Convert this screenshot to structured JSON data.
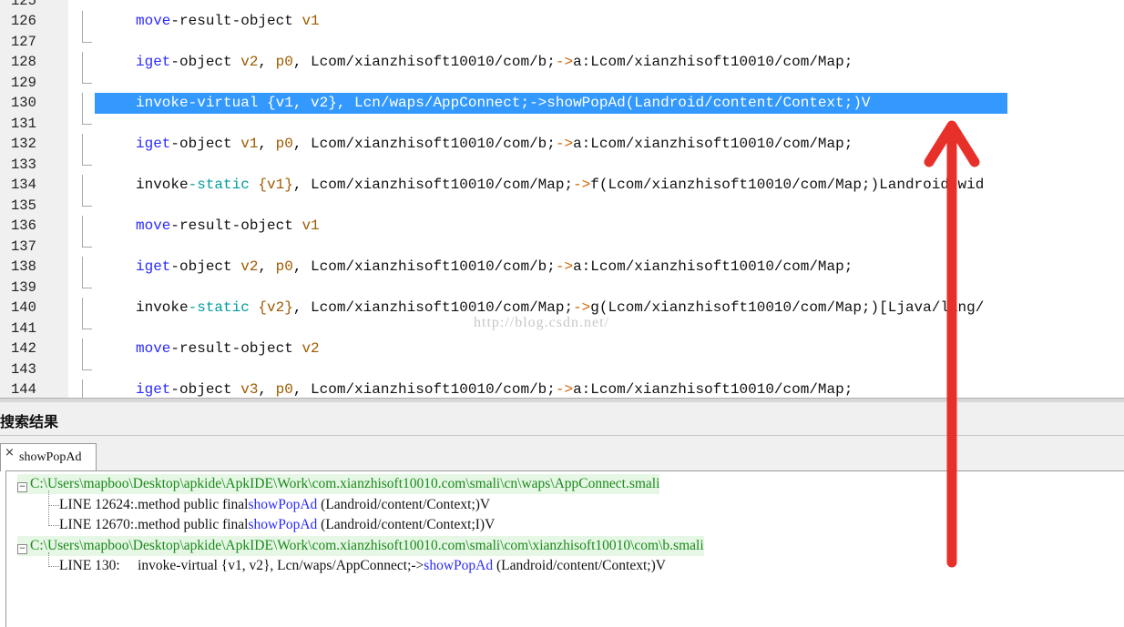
{
  "editor": {
    "partial_top_line_number": "125",
    "lines": [
      {
        "num": "126",
        "parts": [
          {
            "t": "move",
            "c": "kw"
          },
          {
            "t": "-result-object ",
            "c": ""
          },
          {
            "t": "v1",
            "c": "reg"
          }
        ]
      },
      {
        "num": "127",
        "parts": []
      },
      {
        "num": "128",
        "parts": [
          {
            "t": "iget",
            "c": "kw"
          },
          {
            "t": "-object ",
            "c": ""
          },
          {
            "t": "v2",
            "c": "reg"
          },
          {
            "t": ", ",
            "c": ""
          },
          {
            "t": "p0",
            "c": "reg"
          },
          {
            "t": ", Lcom/xianzhisoft10010/com/b;",
            "c": ""
          },
          {
            "t": "->",
            "c": "op"
          },
          {
            "t": "a:Lcom/xianzhisoft10010/com/Map;",
            "c": ""
          }
        ]
      },
      {
        "num": "129",
        "parts": []
      },
      {
        "num": "130",
        "selected": true,
        "parts": [
          {
            "t": "invoke-virtual {v1, v2}, Lcn/waps/AppConnect;->showPopAd(Landroid/content/Context;)V",
            "c": ""
          }
        ]
      },
      {
        "num": "131",
        "parts": []
      },
      {
        "num": "132",
        "parts": [
          {
            "t": "iget",
            "c": "kw"
          },
          {
            "t": "-object ",
            "c": ""
          },
          {
            "t": "v1",
            "c": "reg"
          },
          {
            "t": ", ",
            "c": ""
          },
          {
            "t": "p0",
            "c": "reg"
          },
          {
            "t": ", Lcom/xianzhisoft10010/com/b;",
            "c": ""
          },
          {
            "t": "->",
            "c": "op"
          },
          {
            "t": "a:Lcom/xianzhisoft10010/com/Map;",
            "c": ""
          }
        ]
      },
      {
        "num": "133",
        "parts": []
      },
      {
        "num": "134",
        "parts": [
          {
            "t": "invoke",
            "c": ""
          },
          {
            "t": "-static ",
            "c": "st"
          },
          {
            "t": "{v1}",
            "c": "reg"
          },
          {
            "t": ", Lcom/xianzhisoft10010/com/Map;",
            "c": ""
          },
          {
            "t": "->",
            "c": "op"
          },
          {
            "t": "f(Lcom/xianzhisoft10010/com/Map;)Landroid/wid",
            "c": ""
          }
        ]
      },
      {
        "num": "135",
        "parts": []
      },
      {
        "num": "136",
        "parts": [
          {
            "t": "move",
            "c": "kw"
          },
          {
            "t": "-result-object ",
            "c": ""
          },
          {
            "t": "v1",
            "c": "reg"
          }
        ]
      },
      {
        "num": "137",
        "parts": []
      },
      {
        "num": "138",
        "parts": [
          {
            "t": "iget",
            "c": "kw"
          },
          {
            "t": "-object ",
            "c": ""
          },
          {
            "t": "v2",
            "c": "reg"
          },
          {
            "t": ", ",
            "c": ""
          },
          {
            "t": "p0",
            "c": "reg"
          },
          {
            "t": ", Lcom/xianzhisoft10010/com/b;",
            "c": ""
          },
          {
            "t": "->",
            "c": "op"
          },
          {
            "t": "a:Lcom/xianzhisoft10010/com/Map;",
            "c": ""
          }
        ]
      },
      {
        "num": "139",
        "parts": []
      },
      {
        "num": "140",
        "parts": [
          {
            "t": "invoke",
            "c": ""
          },
          {
            "t": "-static ",
            "c": "st"
          },
          {
            "t": "{v2}",
            "c": "reg"
          },
          {
            "t": ", Lcom/xianzhisoft10010/com/Map;",
            "c": ""
          },
          {
            "t": "->",
            "c": "op"
          },
          {
            "t": "g(Lcom/xianzhisoft10010/com/Map;)[Ljava/lang/",
            "c": ""
          }
        ]
      },
      {
        "num": "141",
        "parts": []
      },
      {
        "num": "142",
        "parts": [
          {
            "t": "move",
            "c": "kw"
          },
          {
            "t": "-result-object ",
            "c": ""
          },
          {
            "t": "v2",
            "c": "reg"
          }
        ]
      },
      {
        "num": "143",
        "parts": []
      },
      {
        "num": "144",
        "parts": [
          {
            "t": "iget",
            "c": "kw"
          },
          {
            "t": "-object ",
            "c": ""
          },
          {
            "t": "v3",
            "c": "reg"
          },
          {
            "t": ", ",
            "c": ""
          },
          {
            "t": "p0",
            "c": "reg"
          },
          {
            "t": ", Lcom/xianzhisoft10010/com/b;",
            "c": ""
          },
          {
            "t": "->",
            "c": "op"
          },
          {
            "t": "a:Lcom/xianzhisoft10010/com/Map;",
            "c": ""
          }
        ]
      }
    ],
    "watermark": "http://blog.csdn.net/"
  },
  "search_panel": {
    "title": "搜索结果",
    "tab_label": "showPopAd",
    "tab_close": "×",
    "results": [
      {
        "type": "file",
        "text": "C:\\Users\\mapboo\\Desktop\\apkide\\ApkIDE\\Work\\com.xianzhisoft10010.com\\smali\\cn\\waps\\AppConnect.smali"
      },
      {
        "type": "hit",
        "prefix": "LINE 12624:.method public final",
        "match": "showPopAd",
        "suffix": " (Landroid/content/Context;)V"
      },
      {
        "type": "hit",
        "prefix": "LINE 12670:.method public final",
        "match": "showPopAd",
        "suffix": " (Landroid/content/Context;I)V"
      },
      {
        "type": "file",
        "text": "C:\\Users\\mapboo\\Desktop\\apkide\\ApkIDE\\Work\\com.xianzhisoft10010.com\\smali\\com\\xianzhisoft10010\\com\\b.smali"
      },
      {
        "type": "hit",
        "prefix": "LINE 130:     invoke-virtual {v1, v2}, Lcn/waps/AppConnect;->",
        "match": "showPopAd",
        "suffix": " (Landroid/content/Context;)V"
      }
    ]
  },
  "colors": {
    "selection": "#3399ff",
    "keyword": "#2b2bff",
    "static": "#009c9c",
    "register": "#a05a00",
    "arrow": "#e8302a",
    "file_path": "#1a8a1a"
  }
}
